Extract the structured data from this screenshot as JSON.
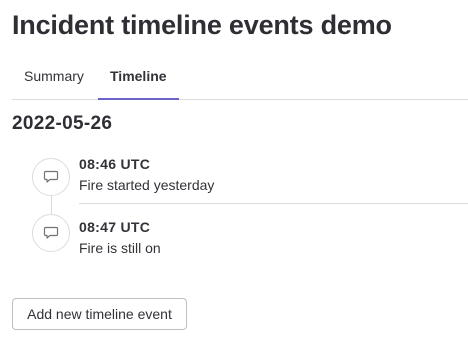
{
  "page": {
    "title": "Incident timeline events demo"
  },
  "tabs": [
    {
      "label": "Summary",
      "active": false
    },
    {
      "label": "Timeline",
      "active": true
    }
  ],
  "timeline": {
    "date": "2022-05-26",
    "events": [
      {
        "time": "08:46 UTC",
        "text": "Fire started yesterday",
        "icon": "comment-icon"
      },
      {
        "time": "08:47 UTC",
        "text": "Fire is still on",
        "icon": "comment-icon"
      }
    ]
  },
  "actions": {
    "add_event_label": "Add new timeline event"
  },
  "colors": {
    "active_tab_underline": "#6c63c8",
    "border": "#dcdcde",
    "text": "#333238"
  }
}
